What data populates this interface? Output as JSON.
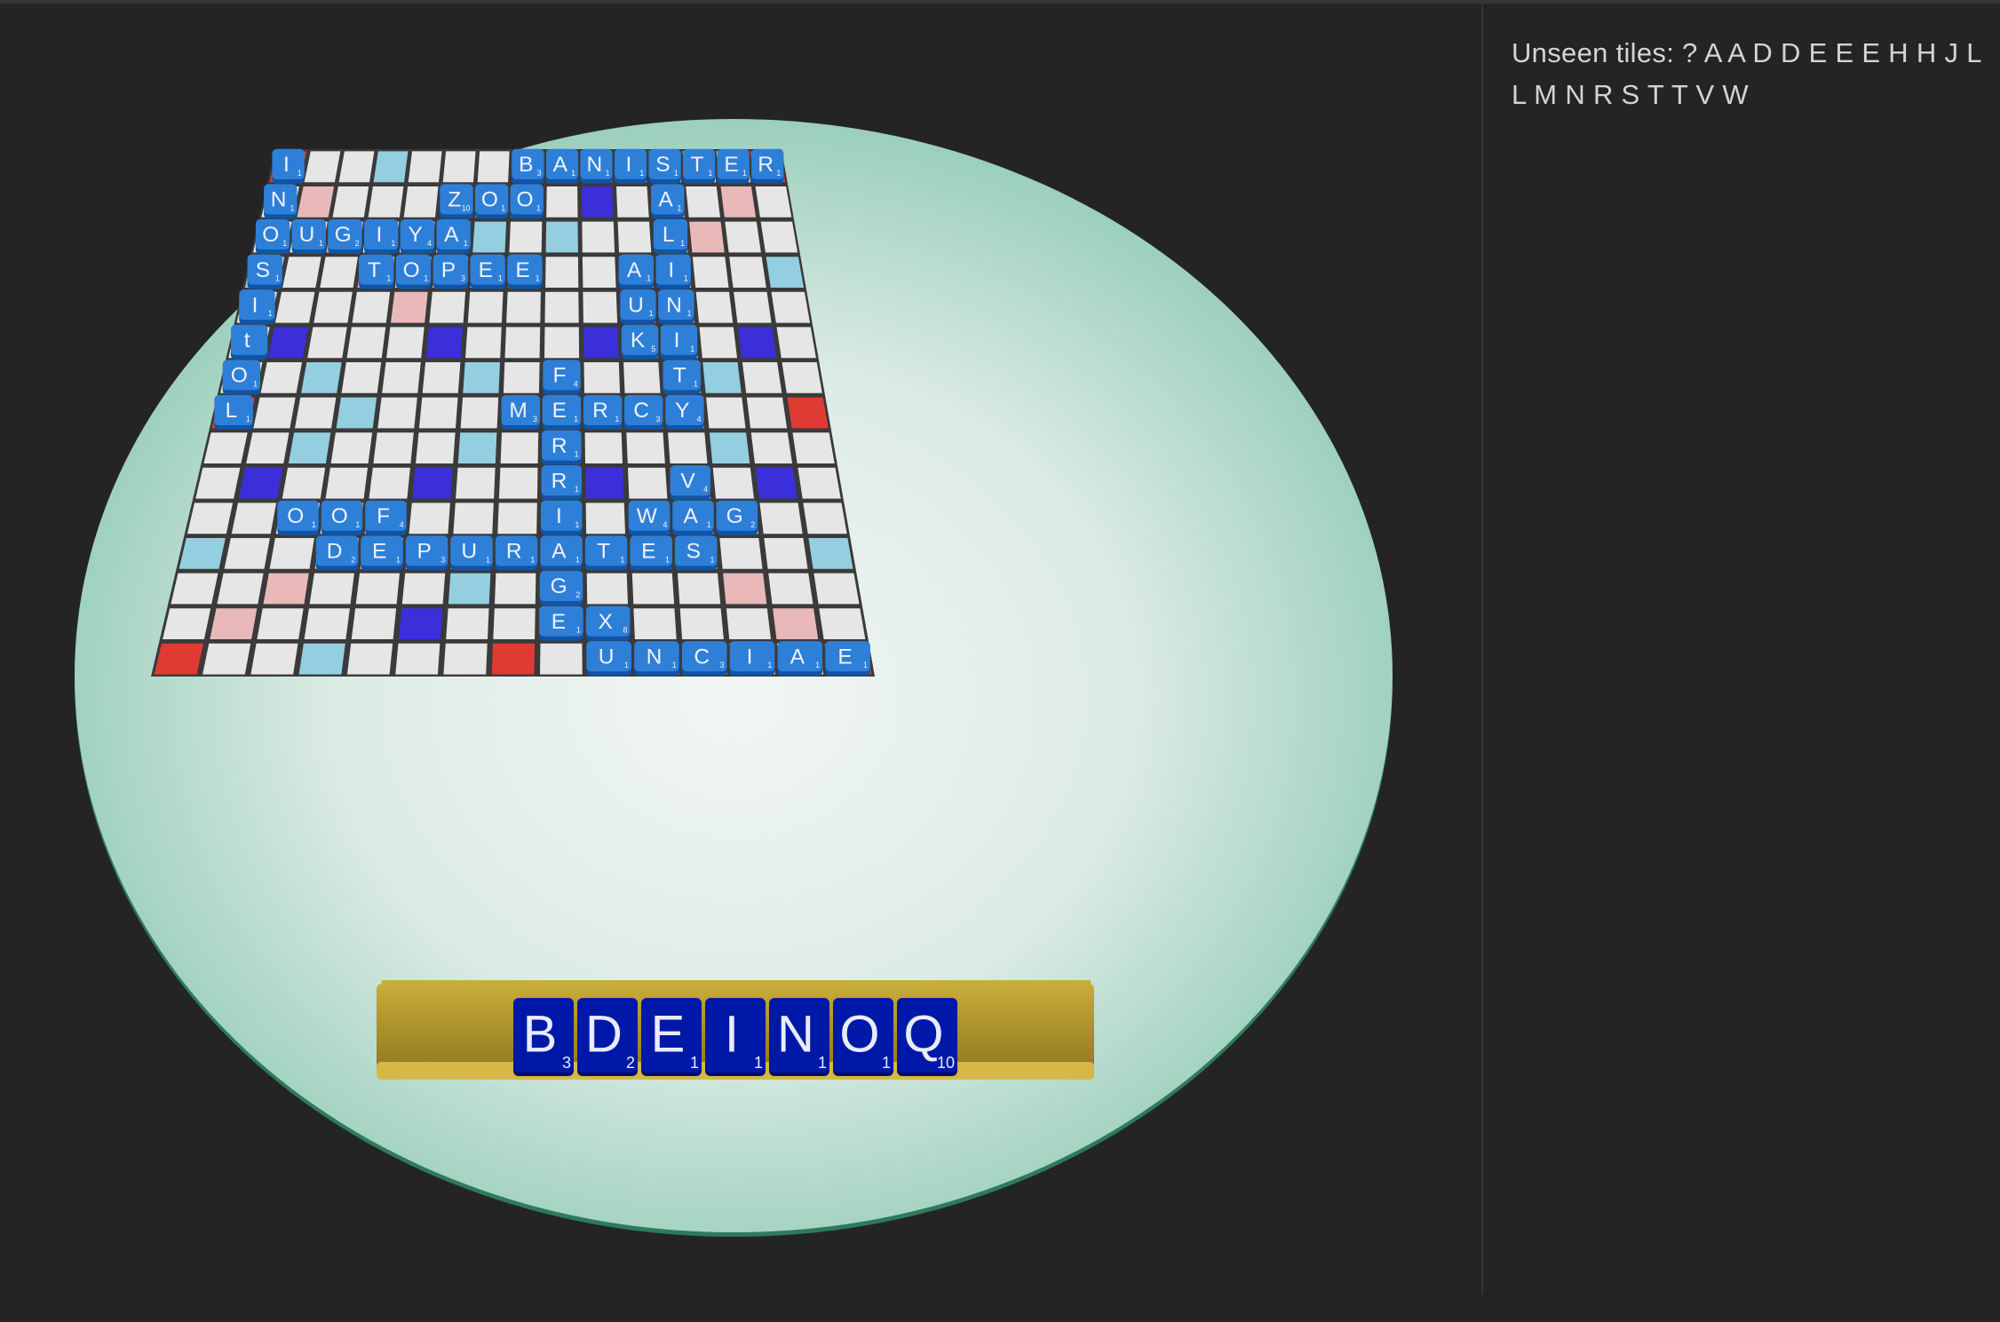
{
  "side_panel": {
    "unseen_label": "Unseen tiles:",
    "unseen_tiles": "? A A D D E E E H H J L L M N R S T T V W"
  },
  "colors": {
    "background": "#242424",
    "table_center": "#eef4f1",
    "table_edge": "#9fd0bf",
    "board_line": "#3a3a3a",
    "square_plain": "#e6e6e6",
    "double_letter": "#93cfe0",
    "triple_letter": "#3b2fd9",
    "double_word": "#e9b9b9",
    "triple_word": "#df3b33",
    "center_star": "#f06a55",
    "tile": "#2e7fd8",
    "tile_dark": "#0f54a8",
    "rack_tile": "#0018a8",
    "rack": "#b49a2e"
  },
  "board": {
    "size": 15,
    "premium_rows": [
      "T..d...T...d..T",
      ".D...t...t...D.",
      "..D...d.d...D..",
      "d..D...d...D..d",
      "....D.....D....",
      ".t...t...t...t.",
      "..d...d.d...d..",
      "T..d...S...d..T",
      "..d...d.d...d..",
      ".t...t...t...t.",
      "....D.....D....",
      "d..D...d...D..d",
      "..D...d.d...D..",
      ".D...t...t...D.",
      "T..d...T...d..T"
    ]
  },
  "placed_tiles": [
    {
      "r": 0,
      "c": 0,
      "l": "I",
      "s": "1"
    },
    {
      "r": 0,
      "c": 7,
      "l": "B",
      "s": "3"
    },
    {
      "r": 0,
      "c": 8,
      "l": "A",
      "s": "1"
    },
    {
      "r": 0,
      "c": 9,
      "l": "N",
      "s": "1"
    },
    {
      "r": 0,
      "c": 10,
      "l": "I",
      "s": "1"
    },
    {
      "r": 0,
      "c": 11,
      "l": "S",
      "s": "1"
    },
    {
      "r": 0,
      "c": 12,
      "l": "T",
      "s": "1"
    },
    {
      "r": 0,
      "c": 13,
      "l": "E",
      "s": "1"
    },
    {
      "r": 0,
      "c": 14,
      "l": "R",
      "s": "1"
    },
    {
      "r": 1,
      "c": 0,
      "l": "N",
      "s": "1"
    },
    {
      "r": 1,
      "c": 5,
      "l": "Z",
      "s": "10"
    },
    {
      "r": 1,
      "c": 6,
      "l": "O",
      "s": "1"
    },
    {
      "r": 1,
      "c": 7,
      "l": "O",
      "s": "1"
    },
    {
      "r": 1,
      "c": 11,
      "l": "A",
      "s": "1"
    },
    {
      "r": 2,
      "c": 0,
      "l": "O",
      "s": "1"
    },
    {
      "r": 2,
      "c": 1,
      "l": "U",
      "s": "1"
    },
    {
      "r": 2,
      "c": 2,
      "l": "G",
      "s": "2"
    },
    {
      "r": 2,
      "c": 3,
      "l": "I",
      "s": "1"
    },
    {
      "r": 2,
      "c": 4,
      "l": "Y",
      "s": "4"
    },
    {
      "r": 2,
      "c": 5,
      "l": "A",
      "s": "1"
    },
    {
      "r": 2,
      "c": 11,
      "l": "L",
      "s": "1"
    },
    {
      "r": 3,
      "c": 0,
      "l": "S",
      "s": "1"
    },
    {
      "r": 3,
      "c": 3,
      "l": "T",
      "s": "1"
    },
    {
      "r": 3,
      "c": 4,
      "l": "O",
      "s": "1"
    },
    {
      "r": 3,
      "c": 5,
      "l": "P",
      "s": "3"
    },
    {
      "r": 3,
      "c": 6,
      "l": "E",
      "s": "1"
    },
    {
      "r": 3,
      "c": 7,
      "l": "E",
      "s": "1"
    },
    {
      "r": 3,
      "c": 10,
      "l": "A",
      "s": "1"
    },
    {
      "r": 3,
      "c": 11,
      "l": "I",
      "s": "1"
    },
    {
      "r": 4,
      "c": 0,
      "l": "I",
      "s": "1"
    },
    {
      "r": 4,
      "c": 10,
      "l": "U",
      "s": "1"
    },
    {
      "r": 4,
      "c": 11,
      "l": "N",
      "s": "1"
    },
    {
      "r": 5,
      "c": 0,
      "l": "t",
      "s": ""
    },
    {
      "r": 5,
      "c": 10,
      "l": "K",
      "s": "5"
    },
    {
      "r": 5,
      "c": 11,
      "l": "I",
      "s": "1"
    },
    {
      "r": 6,
      "c": 0,
      "l": "O",
      "s": "1"
    },
    {
      "r": 6,
      "c": 8,
      "l": "F",
      "s": "4"
    },
    {
      "r": 6,
      "c": 11,
      "l": "T",
      "s": "1"
    },
    {
      "r": 7,
      "c": 0,
      "l": "L",
      "s": "1"
    },
    {
      "r": 7,
      "c": 7,
      "l": "M",
      "s": "3"
    },
    {
      "r": 7,
      "c": 8,
      "l": "E",
      "s": "1"
    },
    {
      "r": 7,
      "c": 9,
      "l": "R",
      "s": "1"
    },
    {
      "r": 7,
      "c": 10,
      "l": "C",
      "s": "3"
    },
    {
      "r": 7,
      "c": 11,
      "l": "Y",
      "s": "4"
    },
    {
      "r": 8,
      "c": 8,
      "l": "R",
      "s": "1"
    },
    {
      "r": 9,
      "c": 8,
      "l": "R",
      "s": "1"
    },
    {
      "r": 9,
      "c": 11,
      "l": "V",
      "s": "4"
    },
    {
      "r": 10,
      "c": 2,
      "l": "O",
      "s": "1"
    },
    {
      "r": 10,
      "c": 3,
      "l": "O",
      "s": "1"
    },
    {
      "r": 10,
      "c": 4,
      "l": "F",
      "s": "4"
    },
    {
      "r": 10,
      "c": 8,
      "l": "I",
      "s": "1"
    },
    {
      "r": 10,
      "c": 10,
      "l": "W",
      "s": "4"
    },
    {
      "r": 10,
      "c": 11,
      "l": "A",
      "s": "1"
    },
    {
      "r": 10,
      "c": 12,
      "l": "G",
      "s": "2"
    },
    {
      "r": 11,
      "c": 3,
      "l": "D",
      "s": "2"
    },
    {
      "r": 11,
      "c": 4,
      "l": "E",
      "s": "1"
    },
    {
      "r": 11,
      "c": 5,
      "l": "P",
      "s": "3"
    },
    {
      "r": 11,
      "c": 6,
      "l": "U",
      "s": "1"
    },
    {
      "r": 11,
      "c": 7,
      "l": "R",
      "s": "1"
    },
    {
      "r": 11,
      "c": 8,
      "l": "A",
      "s": "1"
    },
    {
      "r": 11,
      "c": 9,
      "l": "T",
      "s": "1"
    },
    {
      "r": 11,
      "c": 10,
      "l": "E",
      "s": "1"
    },
    {
      "r": 11,
      "c": 11,
      "l": "S",
      "s": "1"
    },
    {
      "r": 12,
      "c": 8,
      "l": "G",
      "s": "2"
    },
    {
      "r": 13,
      "c": 8,
      "l": "E",
      "s": "1"
    },
    {
      "r": 13,
      "c": 9,
      "l": "X",
      "s": "8"
    },
    {
      "r": 14,
      "c": 9,
      "l": "U",
      "s": "1"
    },
    {
      "r": 14,
      "c": 10,
      "l": "N",
      "s": "1"
    },
    {
      "r": 14,
      "c": 11,
      "l": "C",
      "s": "3"
    },
    {
      "r": 14,
      "c": 12,
      "l": "I",
      "s": "1"
    },
    {
      "r": 14,
      "c": 13,
      "l": "A",
      "s": "1"
    },
    {
      "r": 14,
      "c": 14,
      "l": "E",
      "s": "1"
    }
  ],
  "rack": [
    {
      "l": "B",
      "s": "3"
    },
    {
      "l": "D",
      "s": "2"
    },
    {
      "l": "E",
      "s": "1"
    },
    {
      "l": "I",
      "s": "1"
    },
    {
      "l": "N",
      "s": "1"
    },
    {
      "l": "O",
      "s": "1"
    },
    {
      "l": "Q",
      "s": "10"
    }
  ]
}
